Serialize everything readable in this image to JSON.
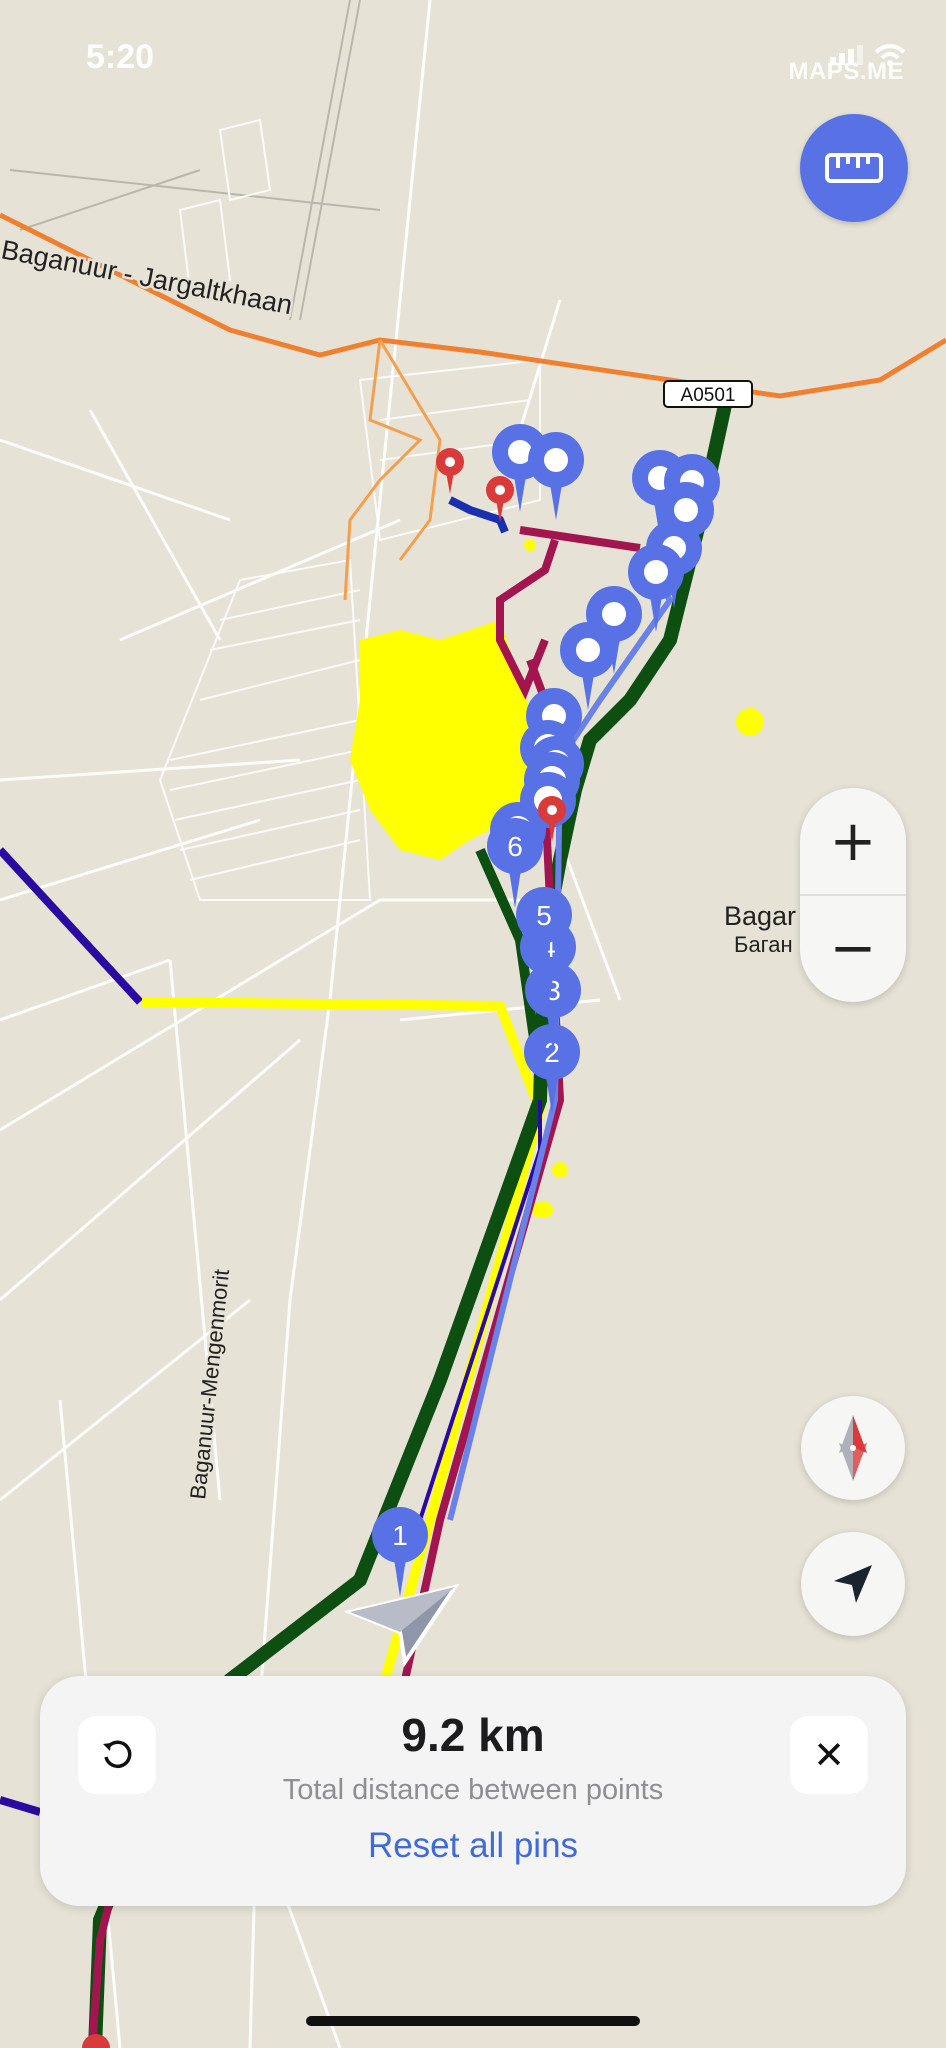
{
  "status_bar": {
    "time": "5:20",
    "brand": "MAPS.ME"
  },
  "map": {
    "road_labels": {
      "highway_1": "Baganuur - Jargaltkhaan",
      "road_2": "Baganuur-Mengenmorit",
      "road_shield": "A0501",
      "city_latin": "Bagar",
      "city_cyrillic": "Баган"
    },
    "numbered_pins": [
      "1",
      "2",
      "3",
      "4",
      "5",
      "6"
    ],
    "colors": {
      "background": "#e6e3d6",
      "pin_blue": "#5872e6",
      "pin_red": "#d93a3a",
      "route_green": "#0c4f10",
      "route_yellow": "#ffff00",
      "route_purple": "#2a0aa0",
      "route_maroon": "#a3154e",
      "road_orange": "#f08030"
    }
  },
  "controls": {
    "ruler_icon": "ruler-icon",
    "zoom_in": "+",
    "zoom_out": "−",
    "compass_icon": "compass-icon",
    "location_icon": "location-arrow-icon"
  },
  "panel": {
    "distance": "9.2 km",
    "subtitle": "Total distance between points",
    "reset_label": "Reset all pins",
    "close_label": "✕"
  }
}
